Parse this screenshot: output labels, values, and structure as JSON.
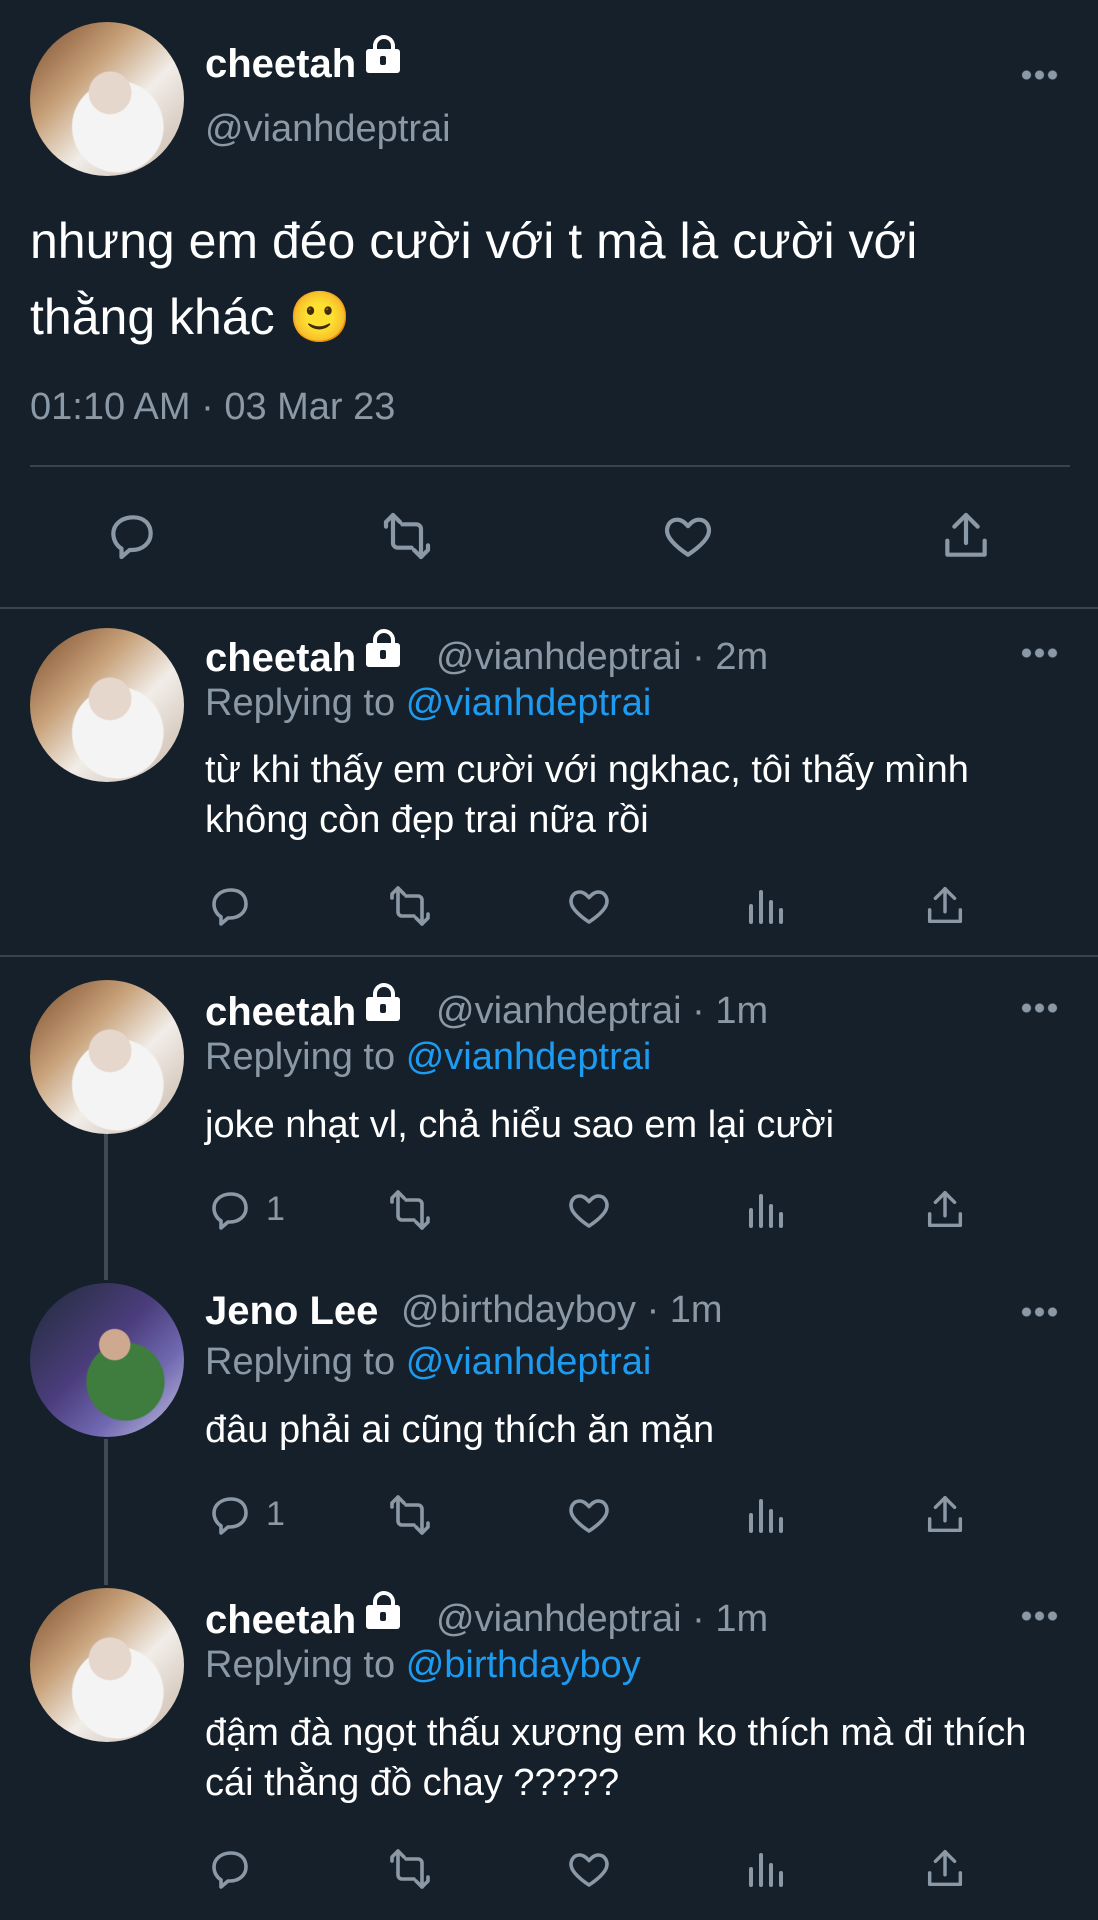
{
  "main_tweet": {
    "name": "cheetah",
    "handle": "@vianhdeptrai",
    "text": "nhưng em đéo cười với t mà là cười với thằng khác 🙂",
    "timestamp": "01:10 AM · 03 Mar 23"
  },
  "replies": [
    {
      "name": "cheetah",
      "meta": "@vianhdeptrai · 2m",
      "replying_label": "Replying to",
      "replying_to": "@vianhdeptrai",
      "text": "từ khi thấy em cười với ngkhac, tôi thấy mình không còn đẹp trai nữa rồi",
      "reply_count": ""
    },
    {
      "name": "cheetah",
      "meta": "@vianhdeptrai · 1m",
      "replying_label": "Replying to",
      "replying_to": "@vianhdeptrai",
      "text": "joke nhạt vl, chả hiểu sao em lại cười",
      "reply_count": "1"
    },
    {
      "name": "Jeno Lee",
      "meta": "@birthdayboy · 1m",
      "replying_label": "Replying to",
      "replying_to": "@vianhdeptrai",
      "text": "đâu phải ai cũng thích ăn mặn",
      "reply_count": "1"
    },
    {
      "name": "cheetah",
      "meta": "@vianhdeptrai · 1m",
      "replying_label": "Replying to",
      "replying_to": "@birthdayboy",
      "text": "đậm đà ngọt thấu xương em ko thích mà đi thích cái thằng đồ chay ?????",
      "reply_count": ""
    }
  ],
  "colors": {
    "background": "#15202b",
    "muted": "#8b98a5",
    "accent": "#1d9bf0",
    "divider": "#38444d"
  },
  "icons": [
    "lock-icon",
    "more-icon",
    "reply-icon",
    "retweet-icon",
    "like-icon",
    "share-icon",
    "views-icon"
  ]
}
